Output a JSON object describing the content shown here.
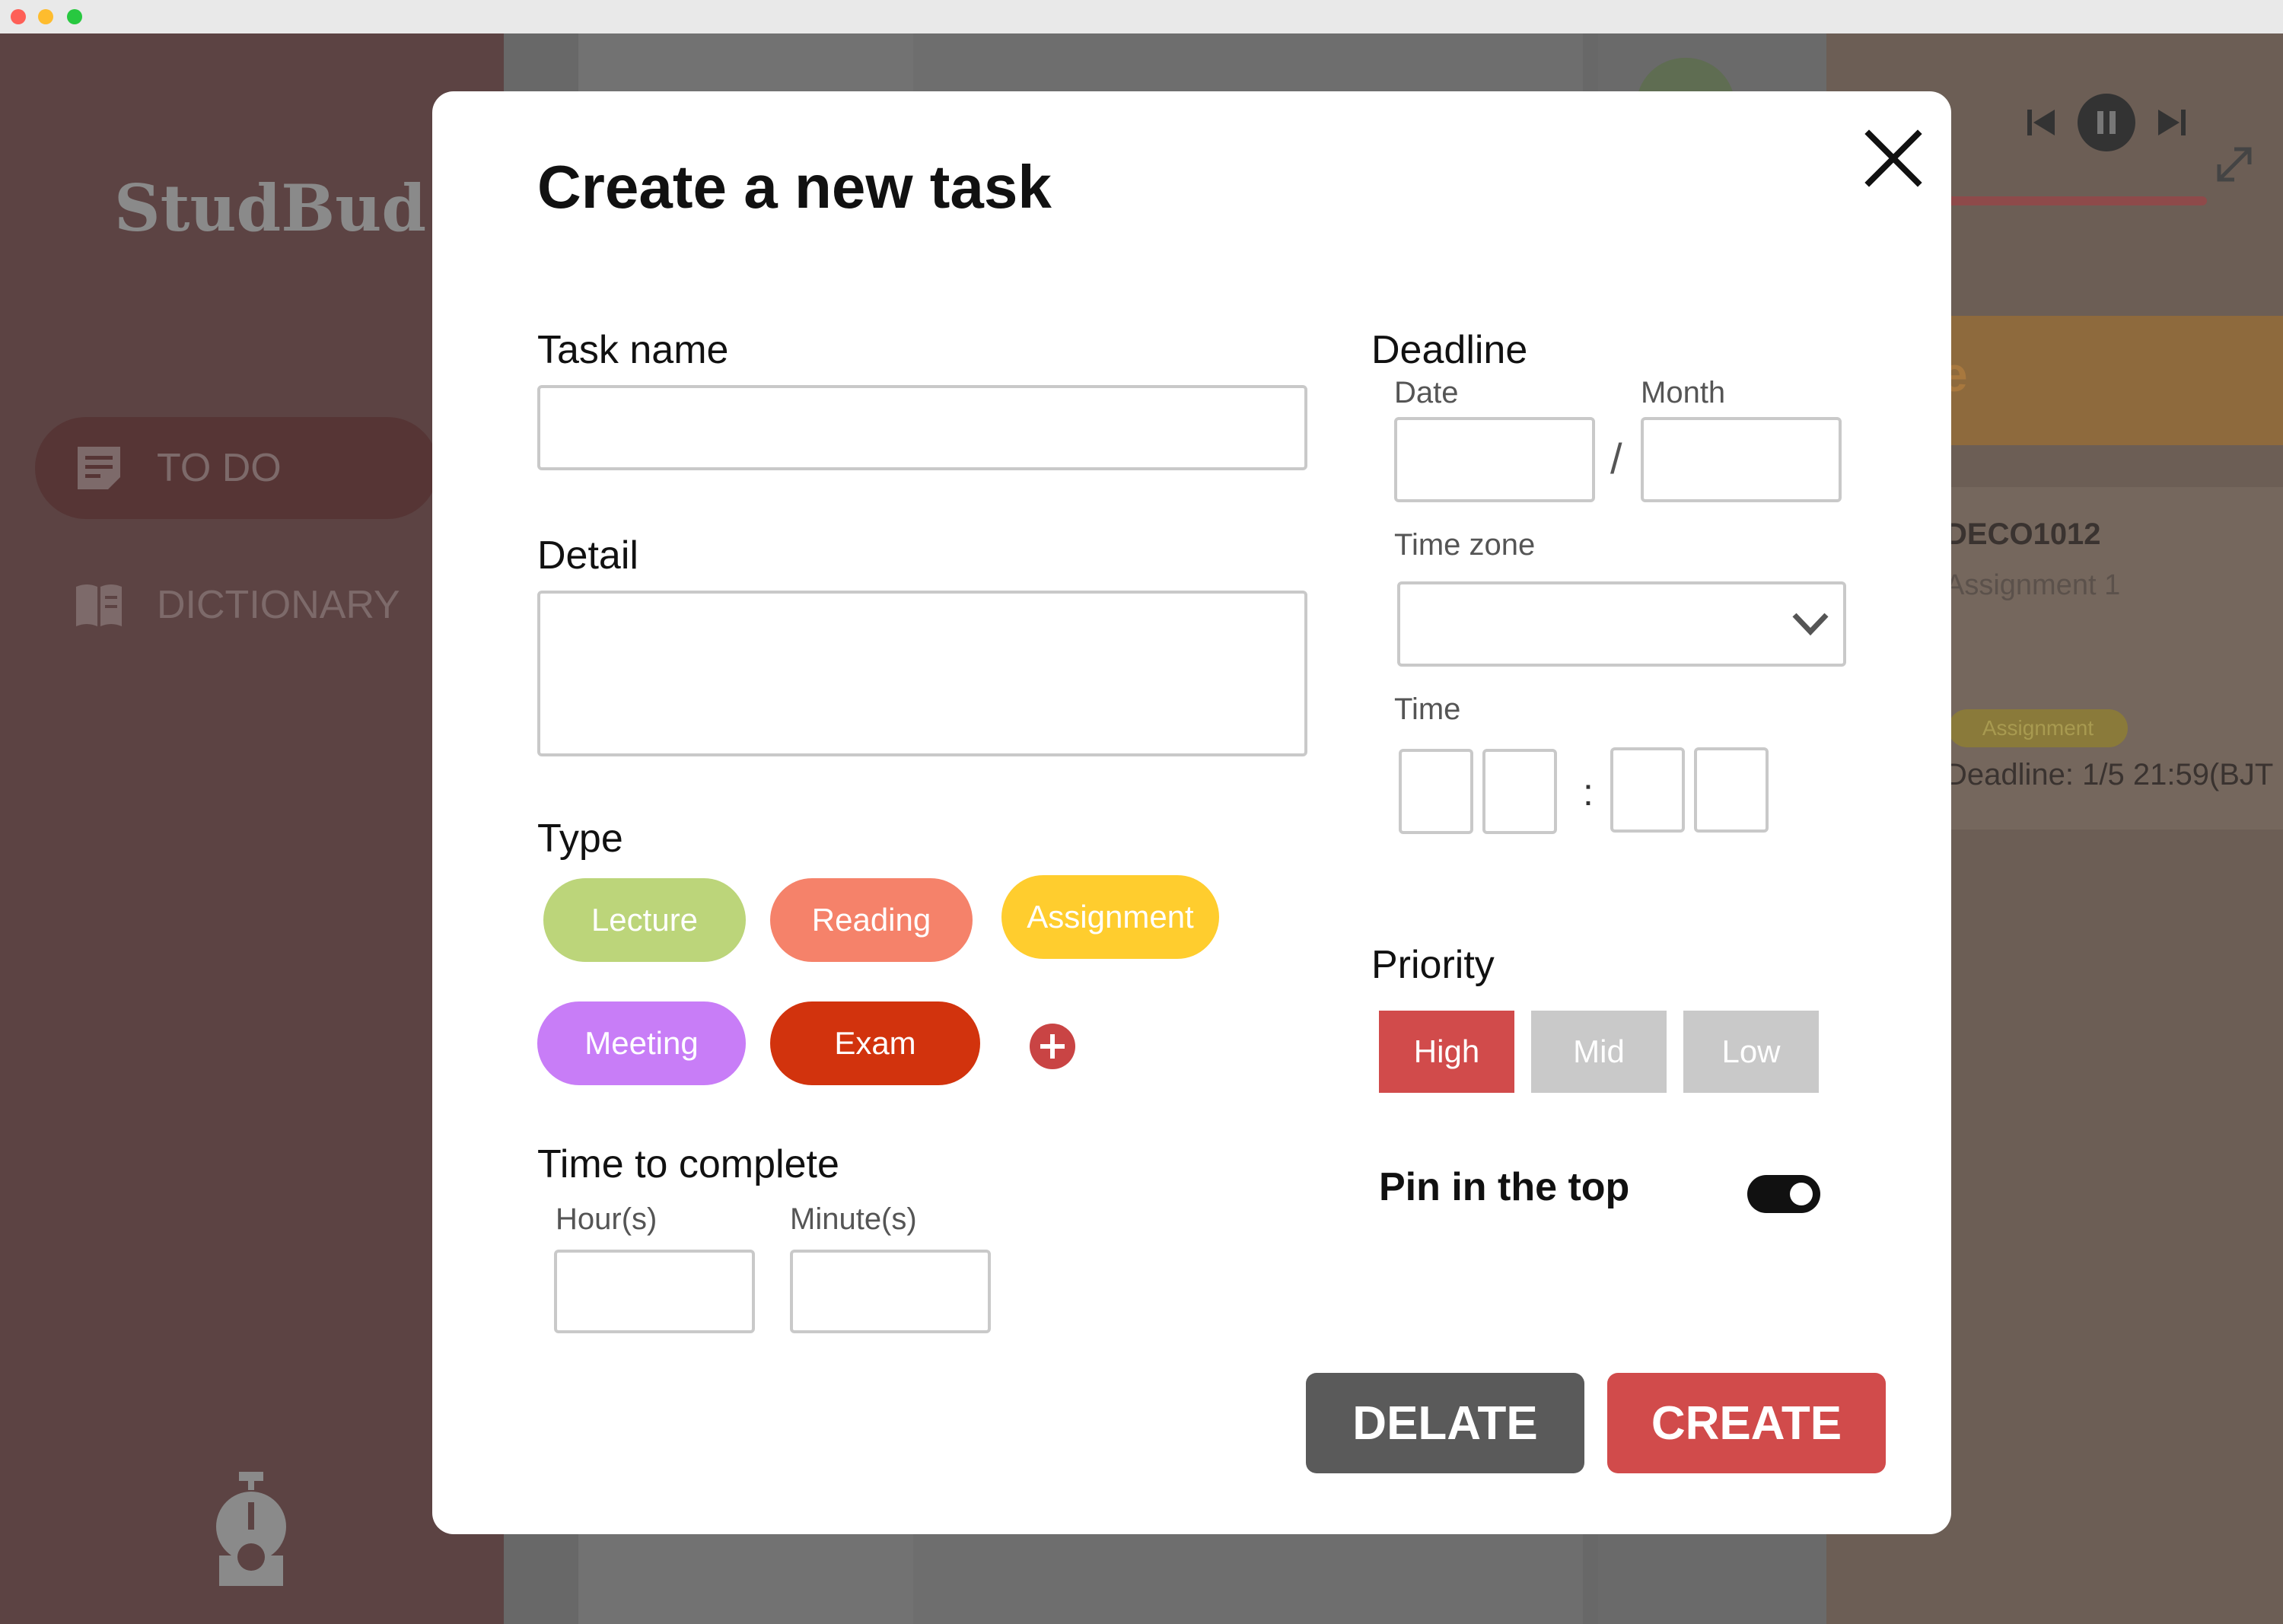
{
  "window": {
    "traffic_lights": [
      "close",
      "minimize",
      "zoom"
    ]
  },
  "background": {
    "logo": "StudBud",
    "nav": [
      {
        "label": "TO DO",
        "icon": "note-icon"
      },
      {
        "label": "DICTIONARY",
        "icon": "book-icon"
      }
    ],
    "right_panel": {
      "header_fragment": "e",
      "course": "DECO1012",
      "assignment": "Assignment 1",
      "tag": "Assignment",
      "deadline": "Deadline: 1/5 21:59(BJT"
    }
  },
  "modal": {
    "title": "Create a new task",
    "task_name": {
      "label": "Task name",
      "value": ""
    },
    "detail": {
      "label": "Detail",
      "value": ""
    },
    "type": {
      "label": "Type",
      "options": [
        {
          "label": "Lecture",
          "color": "#bcd57a"
        },
        {
          "label": "Reading",
          "color": "#f5826a"
        },
        {
          "label": "Assignment",
          "color": "#ffcd2e"
        },
        {
          "label": "Meeting",
          "color": "#c87df7"
        },
        {
          "label": "Exam",
          "color": "#d2330d"
        }
      ],
      "add_icon": "plus-circle-icon"
    },
    "time_to_complete": {
      "label": "Time to complete",
      "hours_label": "Hour(s)",
      "minutes_label": "Minute(s)"
    },
    "deadline": {
      "label": "Deadline",
      "date_label": "Date",
      "month_label": "Month",
      "separator": "/",
      "timezone_label": "Time zone",
      "timezone_value": "",
      "time_label": "Time",
      "time_separator": ":"
    },
    "priority": {
      "label": "Priority",
      "options": [
        {
          "label": "High",
          "selected": true
        },
        {
          "label": "Mid",
          "selected": false
        },
        {
          "label": "Low",
          "selected": false
        }
      ],
      "selected_color": "#d14b4b",
      "unselected_color": "#c9c9c9"
    },
    "pin": {
      "label": "Pin in the top",
      "on": true
    },
    "buttons": {
      "delete": "DELATE",
      "create": "CREATE"
    },
    "colors": {
      "delete_bg": "#5a5a5a",
      "create_bg": "#d14b4b",
      "add_icon": "#c94444"
    }
  }
}
